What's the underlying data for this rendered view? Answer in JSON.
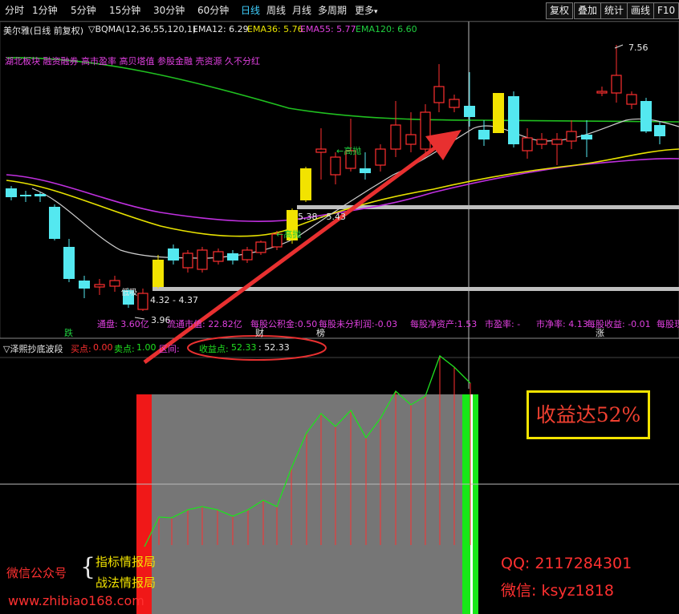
{
  "toolbar": {
    "tabs": [
      "分时",
      "1分钟",
      "5分钟",
      "15分钟",
      "30分钟",
      "60分钟",
      "日线",
      "周线",
      "月线",
      "多周期",
      "更多"
    ],
    "more_arrow": "▾",
    "right_buttons": [
      "复权",
      "叠加",
      "统计",
      "画线",
      "F10"
    ]
  },
  "ma_line": {
    "stock": "美尔雅(日线 前复权)",
    "indicator": "▽BQMA(12,36,55,120,1)",
    "ema12": "EMA12: 6.29",
    "ema36": "EMA36: 5.76",
    "ema55": "EMA55: 5.77",
    "ema120": "EMA120: 6.60"
  },
  "concept_tags": "湖北板块 融资融券 高市盈率 高贝塔值 参股金融 壳资源 久不分红",
  "annotations": {
    "high_price": "7.56",
    "low_price": "3.96",
    "zone_upper": "5.38 - 5.43",
    "zone_lower": "4.32 - 4.37",
    "high_throw_1": "←高抛",
    "high_throw_2": "←高抛",
    "low_buy": "低吸"
  },
  "fundamentals": [
    "通盘: 3.60亿",
    "流通市值: 22.82亿",
    "每股公积金:0.50",
    "每股未分利润:-0.03",
    "每股净资产:1.53",
    "市盈率: -",
    "市净率: 4.13",
    "每股收益: -0.01",
    "每股现"
  ],
  "markers": {
    "die": "跌",
    "cai": "财",
    "bang": "榜",
    "zhang": "涨"
  },
  "sub_indicator": {
    "name": "▽泽熙抄底波段",
    "buy_label": "买点:",
    "buy_value": "0.00",
    "sell_label": "卖点:",
    "sell_value": "1.00",
    "range_label": "区间:",
    "profit_label": "收益点:",
    "profit_value": "52.33",
    "profit_value2": ": 52.33"
  },
  "overlay": {
    "profit_box": "收益达52%",
    "wechat_label": "微信公众号",
    "brace": "{",
    "item1": "指标情报局",
    "item2": "战法情报局",
    "website": "www.zhibiao168.com",
    "qq": "QQ: 2117284301",
    "weixin": "微信: ksyz1818"
  },
  "colors": {
    "rise": "#ff3030",
    "fall": "#54e8f0",
    "yellow_candle": "#f2e300",
    "ema12": "#cfcfcf",
    "ema36": "#e8e200",
    "ema55": "#c030e0",
    "ema120": "#20c020",
    "annotation_arrow": "#e83030"
  }
}
